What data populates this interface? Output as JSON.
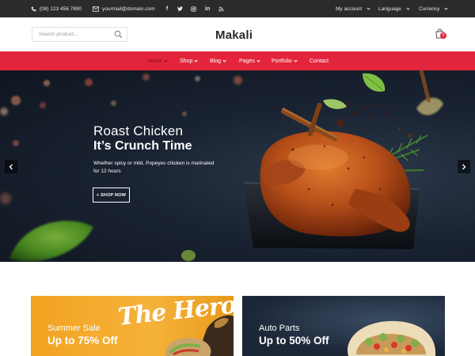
{
  "topbar": {
    "phone": "(08) 123 456 7890",
    "email": "yourmail@domain.com",
    "social": [
      "facebook-icon",
      "twitter-icon",
      "instagram-icon",
      "linkedin-icon",
      "rss-icon"
    ],
    "my_account": "My account",
    "language": "Language",
    "currency": "Currency"
  },
  "header": {
    "search_placeholder": "Search product...",
    "logo": "Makali",
    "cart_count": "0"
  },
  "nav": {
    "items": [
      {
        "label": "Home",
        "dropdown": true,
        "active": true
      },
      {
        "label": "Shop",
        "dropdown": true,
        "active": false
      },
      {
        "label": "Blog",
        "dropdown": true,
        "active": false
      },
      {
        "label": "Pages",
        "dropdown": true,
        "active": false
      },
      {
        "label": "Portfolio",
        "dropdown": true,
        "active": false
      },
      {
        "label": "Contact",
        "dropdown": false,
        "active": false
      }
    ]
  },
  "hero": {
    "title_line1": "Roast Chicken",
    "title_line2": "It’s Crunch Time",
    "description": "Whether spicy or mild, Popeyes chicken is marinated for 12 hours",
    "button": "+ SHOP NOW"
  },
  "banners": [
    {
      "subtitle": "Summer Sale",
      "headline": "Up to 75% Off",
      "artwork_text": "The Hero"
    },
    {
      "subtitle": "Auto Parts",
      "headline": "Up to 50% Off"
    }
  ],
  "colors": {
    "accent": "#e3253c",
    "topbar": "#2b2b2b",
    "hero_bg": "#1a2332",
    "banner_orange": "#f2a320"
  }
}
